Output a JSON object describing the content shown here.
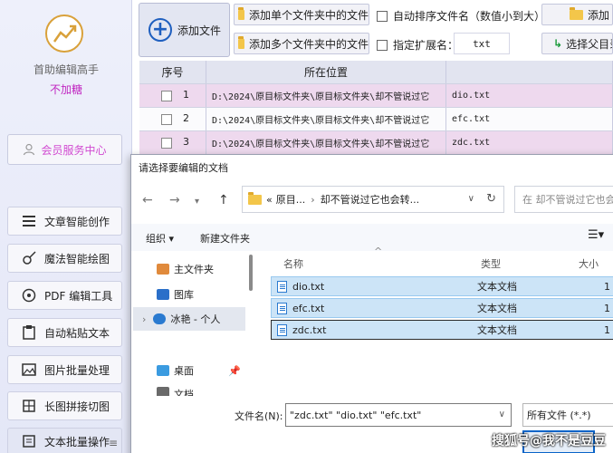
{
  "sidebar": {
    "app_name": "首助编辑高手",
    "app_sub": "不加糖",
    "member_button": "会员服务中心",
    "items": [
      {
        "label": "文章智能创作",
        "icon": "menu-list-icon"
      },
      {
        "label": "魔法智能绘图",
        "icon": "magic-brush-icon"
      },
      {
        "label": "PDF 编辑工具",
        "icon": "pdf-icon"
      },
      {
        "label": "自动粘贴文本",
        "icon": "paste-icon"
      },
      {
        "label": "图片批量处理",
        "icon": "image-icon"
      },
      {
        "label": "长图拼接切图",
        "icon": "grid-icon"
      },
      {
        "label": "文本批量操作",
        "icon": "text-file-icon"
      }
    ],
    "handle": "≡"
  },
  "toolbar": {
    "add_file": "添加文件",
    "add_single_folder": "添加单个文件夹中的文件",
    "add_multi_folder": "添加多个文件夹中的文件",
    "auto_sort": "自动排序文件名（数值小到大）",
    "specify_ext": "指定扩展名：",
    "ext_value": "txt",
    "add_more": "添加",
    "select_parent": "选择父目录"
  },
  "table": {
    "headers": {
      "index": "序号",
      "location": "所在位置",
      "name": ""
    },
    "rows": [
      {
        "index": "1",
        "location": "D:\\2024\\原目标文件夹\\原目标文件夹\\却不管说过它",
        "name": "dio.txt"
      },
      {
        "index": "2",
        "location": "D:\\2024\\原目标文件夹\\原目标文件夹\\却不管说过它",
        "name": "efc.txt"
      },
      {
        "index": "3",
        "location": "D:\\2024\\原目标文件夹\\原目标文件夹\\却不管说过它",
        "name": "zdc.txt"
      }
    ]
  },
  "dialog": {
    "title": "请选择要编辑的文档",
    "address": {
      "prefix": "«",
      "crumb1": "原目...",
      "crumb2": "却不管说过它也会转..."
    },
    "search_placeholder": "在 却不管说过它也会",
    "organize": "组织 ▾",
    "new_folder": "新建文件夹",
    "nav": {
      "home": "主文件夹",
      "pictures": "图库",
      "cloud": "冰艳 - 个人",
      "desktop": "桌面",
      "docs": "文档"
    },
    "columns": {
      "name": "名称",
      "type": "类型",
      "size": "大小"
    },
    "files": [
      {
        "name": "dio.txt",
        "type": "文本文档",
        "size": "1"
      },
      {
        "name": "efc.txt",
        "type": "文本文档",
        "size": "1"
      },
      {
        "name": "zdc.txt",
        "type": "文本文档",
        "size": "1"
      }
    ],
    "filename_label": "文件名(N):",
    "filename_value": "\"zdc.txt\" \"dio.txt\" \"efc.txt\"",
    "filetype": "所有文件 (*.*)"
  },
  "watermark": "搜狐号@我不是豆豆"
}
